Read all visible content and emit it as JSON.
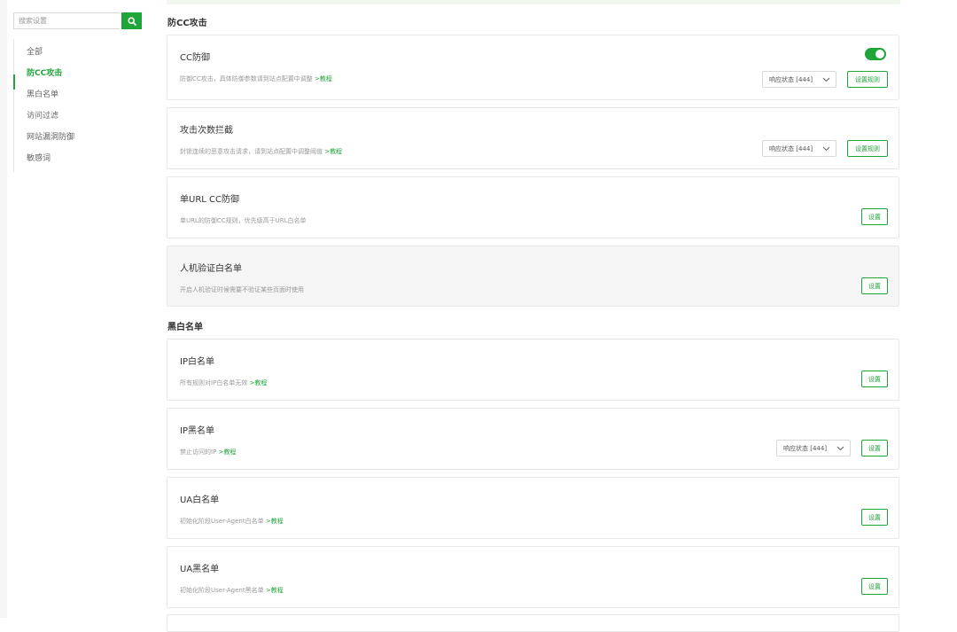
{
  "sidebar": {
    "search_placeholder": "搜索设置",
    "items": [
      {
        "label": "全部"
      },
      {
        "label": "防CC攻击"
      },
      {
        "label": "黑白名单"
      },
      {
        "label": "访问过滤"
      },
      {
        "label": "网站漏洞防御"
      },
      {
        "label": "敏感词"
      }
    ],
    "active_index": 1,
    "accent_color": "#20a53a"
  },
  "sections": {
    "cc": {
      "title": "防CC攻击"
    },
    "list": {
      "title": "黑白名单"
    }
  },
  "cards": {
    "cc_defense": {
      "title": "CC防御",
      "desc": "防御CC攻击，具体防御参数请到站点配置中调整",
      "link": ">教程",
      "toggle_on": true,
      "select": "响应状态 [444]",
      "button": "设置规则"
    },
    "attack_block": {
      "title": "攻击次数拦截",
      "desc": "封锁连续的恶意攻击请求，请到站点配置中调整阈值",
      "link": ">教程",
      "select": "响应状态 [444]",
      "button": "设置规则"
    },
    "url_cc": {
      "title": "单URL CC防御",
      "desc": "单URL的防御CC规则，优先级高于URL白名单",
      "button": "设置"
    },
    "captcha_white": {
      "title": "人机验证白名单",
      "desc": "开启人机验证时候需要不验证某些页面时使用",
      "button": "设置"
    },
    "ip_white": {
      "title": "IP白名单",
      "desc": "所有规则对IP白名单无效",
      "link": ">教程",
      "button": "设置"
    },
    "ip_black": {
      "title": "IP黑名单",
      "desc": "禁止访问的IP",
      "link": ">教程",
      "select": "响应状态 [444]",
      "button": "设置"
    },
    "ua_white": {
      "title": "UA白名单",
      "desc": "初始化阶段User-Agent白名单",
      "link": ">教程",
      "button": "设置"
    },
    "ua_black": {
      "title": "UA黑名单",
      "desc": "初始化阶段User-Agent黑名单",
      "link": ">教程",
      "button": "设置"
    }
  },
  "icons": {
    "search": "search-icon",
    "chevron": "chevron-down-icon"
  }
}
